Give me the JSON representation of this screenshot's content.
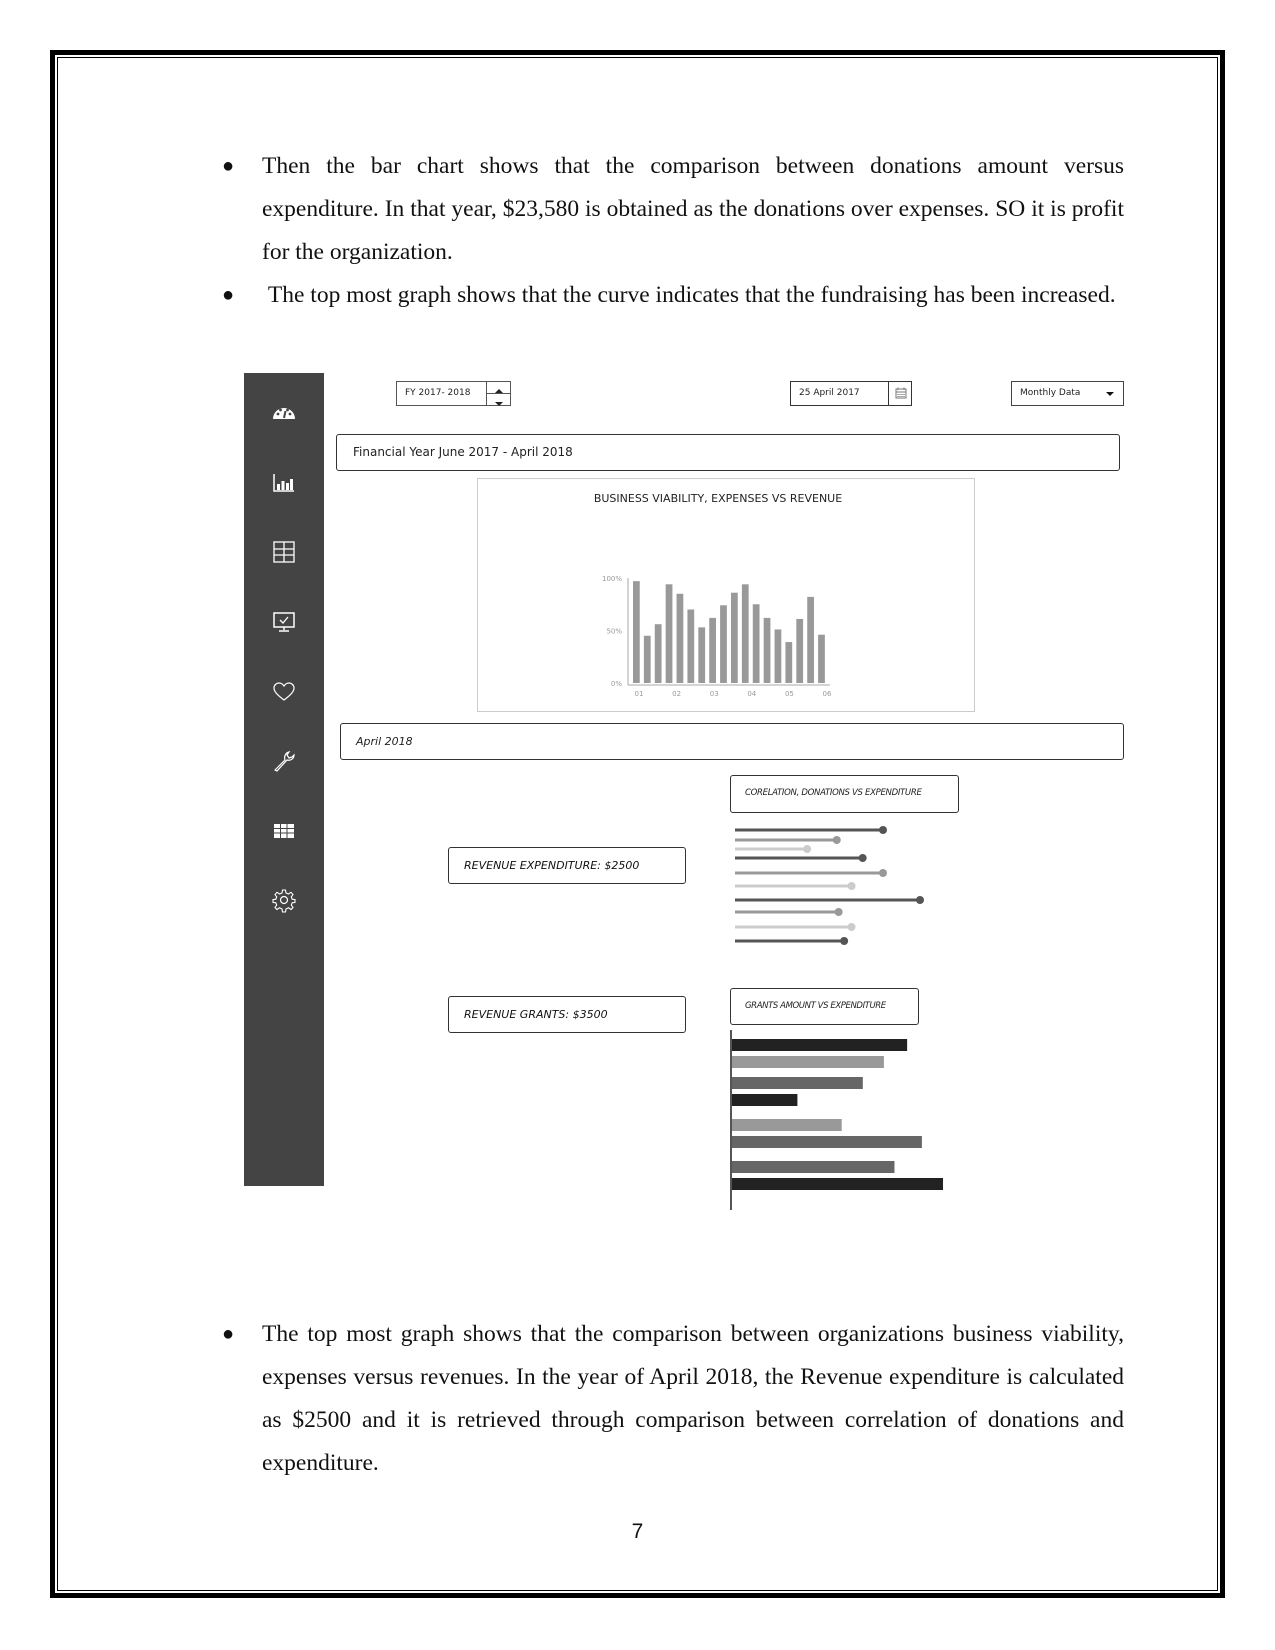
{
  "document": {
    "bullets_top": [
      "Then the bar chart shows that the comparison between donations amount versus expenditure. In that year, $23,580 is obtained as the donations over expenses. SO it is profit for the organization.",
      " The top most graph shows that the curve indicates that the fundraising has been increased."
    ],
    "bullets_bottom": [
      "The top most graph shows that the comparison between organizations business viability, expenses versus revenues. In the year of April 2018, the Revenue expenditure is calculated as $2500 and it is retrieved through comparison between correlation of donations and expenditure."
    ],
    "page_number": "7"
  },
  "dashboard": {
    "sidebar": {
      "icons": [
        "dashboard-gauge-icon",
        "bar-chart-icon",
        "grid-icon",
        "monitor-check-icon",
        "heart-icon",
        "wrench-icon",
        "table-icon",
        "gear-icon"
      ]
    },
    "toolbar": {
      "fiscal_year": "FY 2017- 2018",
      "date": "25 April 2017",
      "view_select": "Monthly Data"
    },
    "financial_year_label": "Financial Year June 2017 - April 2018",
    "period_label": "April 2018",
    "revenue_expenditure": "REVENUE  EXPENDITURE: $2500",
    "revenue_grants": "REVENUE GRANTS: $3500",
    "correlation_title": "CORELATION, DONATIONS VS EXPENDITURE",
    "grants_title": "GRANTS AMOUNT VS EXPENDITURE"
  },
  "chart_data": [
    {
      "type": "bar",
      "title": "BUSINESS VIABILITY, EXPENSES VS REVENUE",
      "categories": [
        "01",
        "02",
        "03",
        "04",
        "05",
        "06"
      ],
      "yticks": [
        "0%",
        "50%",
        "100%"
      ],
      "ylim": [
        0,
        100
      ],
      "values": [
        97,
        45,
        56,
        94,
        85,
        70,
        53,
        62,
        74,
        86,
        94,
        75,
        62,
        51,
        39,
        61,
        82,
        46
      ],
      "xlabel": "",
      "ylabel": ""
    },
    {
      "type": "lollipop",
      "title": "CORELATION, DONATIONS VS EXPENDITURE",
      "values": [
        80,
        55,
        39,
        69,
        80,
        63,
        100,
        56,
        63,
        59
      ],
      "shades": [
        "#555555",
        "#999999",
        "#cccccc",
        "#555555",
        "#999999",
        "#cccccc",
        "#555555",
        "#999999",
        "#cccccc",
        "#555555"
      ]
    },
    {
      "type": "bar",
      "orientation": "horizontal",
      "title": "GRANTS AMOUNT VS EXPENDITURE",
      "values": [
        83,
        72,
        62,
        31,
        52,
        90,
        77,
        100
      ],
      "shades": [
        "#222222",
        "#999999",
        "#666666",
        "#222222",
        "#999999",
        "#666666",
        "#666666",
        "#222222"
      ]
    }
  ]
}
